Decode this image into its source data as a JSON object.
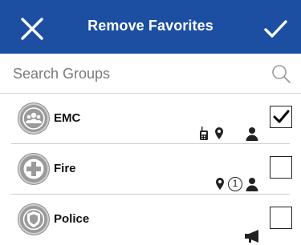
{
  "header": {
    "title": "Remove Favorites",
    "background": "#1c4fa1"
  },
  "search": {
    "placeholder": "Search Groups"
  },
  "groups": [
    {
      "name": "EMC",
      "icon": "group-people-icon",
      "checked": true,
      "status_icons": [
        "radio-icon",
        "location-pin-icon",
        "person-icon"
      ]
    },
    {
      "name": "Fire",
      "icon": "fire-cross-icon",
      "checked": false,
      "status_icons": [
        "location-pin-icon",
        "count-badge-icon",
        "person-icon"
      ],
      "count_badge": "1"
    },
    {
      "name": "Police",
      "icon": "police-shield-icon",
      "checked": false,
      "status_icons": [
        "megaphone-icon"
      ]
    }
  ]
}
